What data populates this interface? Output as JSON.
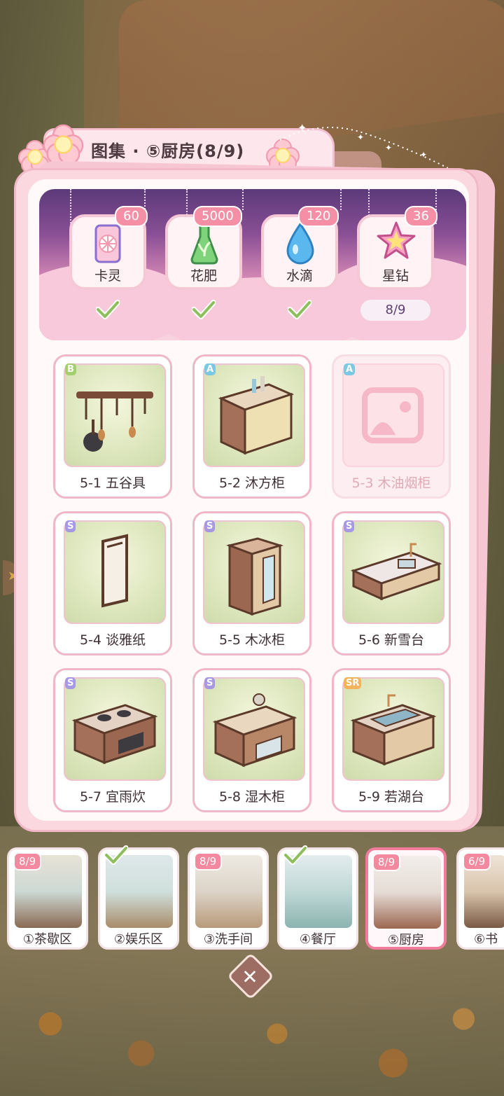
{
  "title": "图集 · ⑤厨房(8/9)",
  "rewards": [
    {
      "label": "卡灵",
      "count": "60",
      "claimed": true,
      "icon": "card-icon"
    },
    {
      "label": "花肥",
      "count": "5000",
      "claimed": true,
      "icon": "fertilizer-flask-icon"
    },
    {
      "label": "水滴",
      "count": "120",
      "claimed": true,
      "icon": "water-drop-icon"
    },
    {
      "label": "星钻",
      "count": "36",
      "claimed": false,
      "progress": "8/9",
      "icon": "star-diamond-icon"
    }
  ],
  "items": [
    {
      "label": "5-1 五谷具",
      "rarity": "B",
      "collected": true
    },
    {
      "label": "5-2 沐方柜",
      "rarity": "A",
      "collected": true
    },
    {
      "label": "5-3 木油烟柜",
      "rarity": "A",
      "collected": false
    },
    {
      "label": "5-4 谈雅纸",
      "rarity": "S",
      "collected": true
    },
    {
      "label": "5-5 木冰柜",
      "rarity": "S",
      "collected": true
    },
    {
      "label": "5-6 新雪台",
      "rarity": "S",
      "collected": true
    },
    {
      "label": "5-7 宜雨炊",
      "rarity": "S",
      "collected": true
    },
    {
      "label": "5-8 湿木柜",
      "rarity": "S",
      "collected": true
    },
    {
      "label": "5-9 若湖台",
      "rarity": "SR",
      "collected": true
    }
  ],
  "areas": [
    {
      "label": "①茶歇区",
      "tag": "8/9",
      "complete": false
    },
    {
      "label": "②娱乐区",
      "tag": "",
      "complete": true
    },
    {
      "label": "③洗手间",
      "tag": "8/9",
      "complete": false
    },
    {
      "label": "④餐厅",
      "tag": "",
      "complete": true
    },
    {
      "label": "⑤厨房",
      "tag": "8/9",
      "complete": false,
      "active": true
    },
    {
      "label": "⑥书",
      "tag": "6/9",
      "complete": false
    }
  ],
  "close_symbol": "✕",
  "colors": {
    "accent": "#f07b9b",
    "panel": "#fbd8e0",
    "check": "#8dbf5c"
  }
}
